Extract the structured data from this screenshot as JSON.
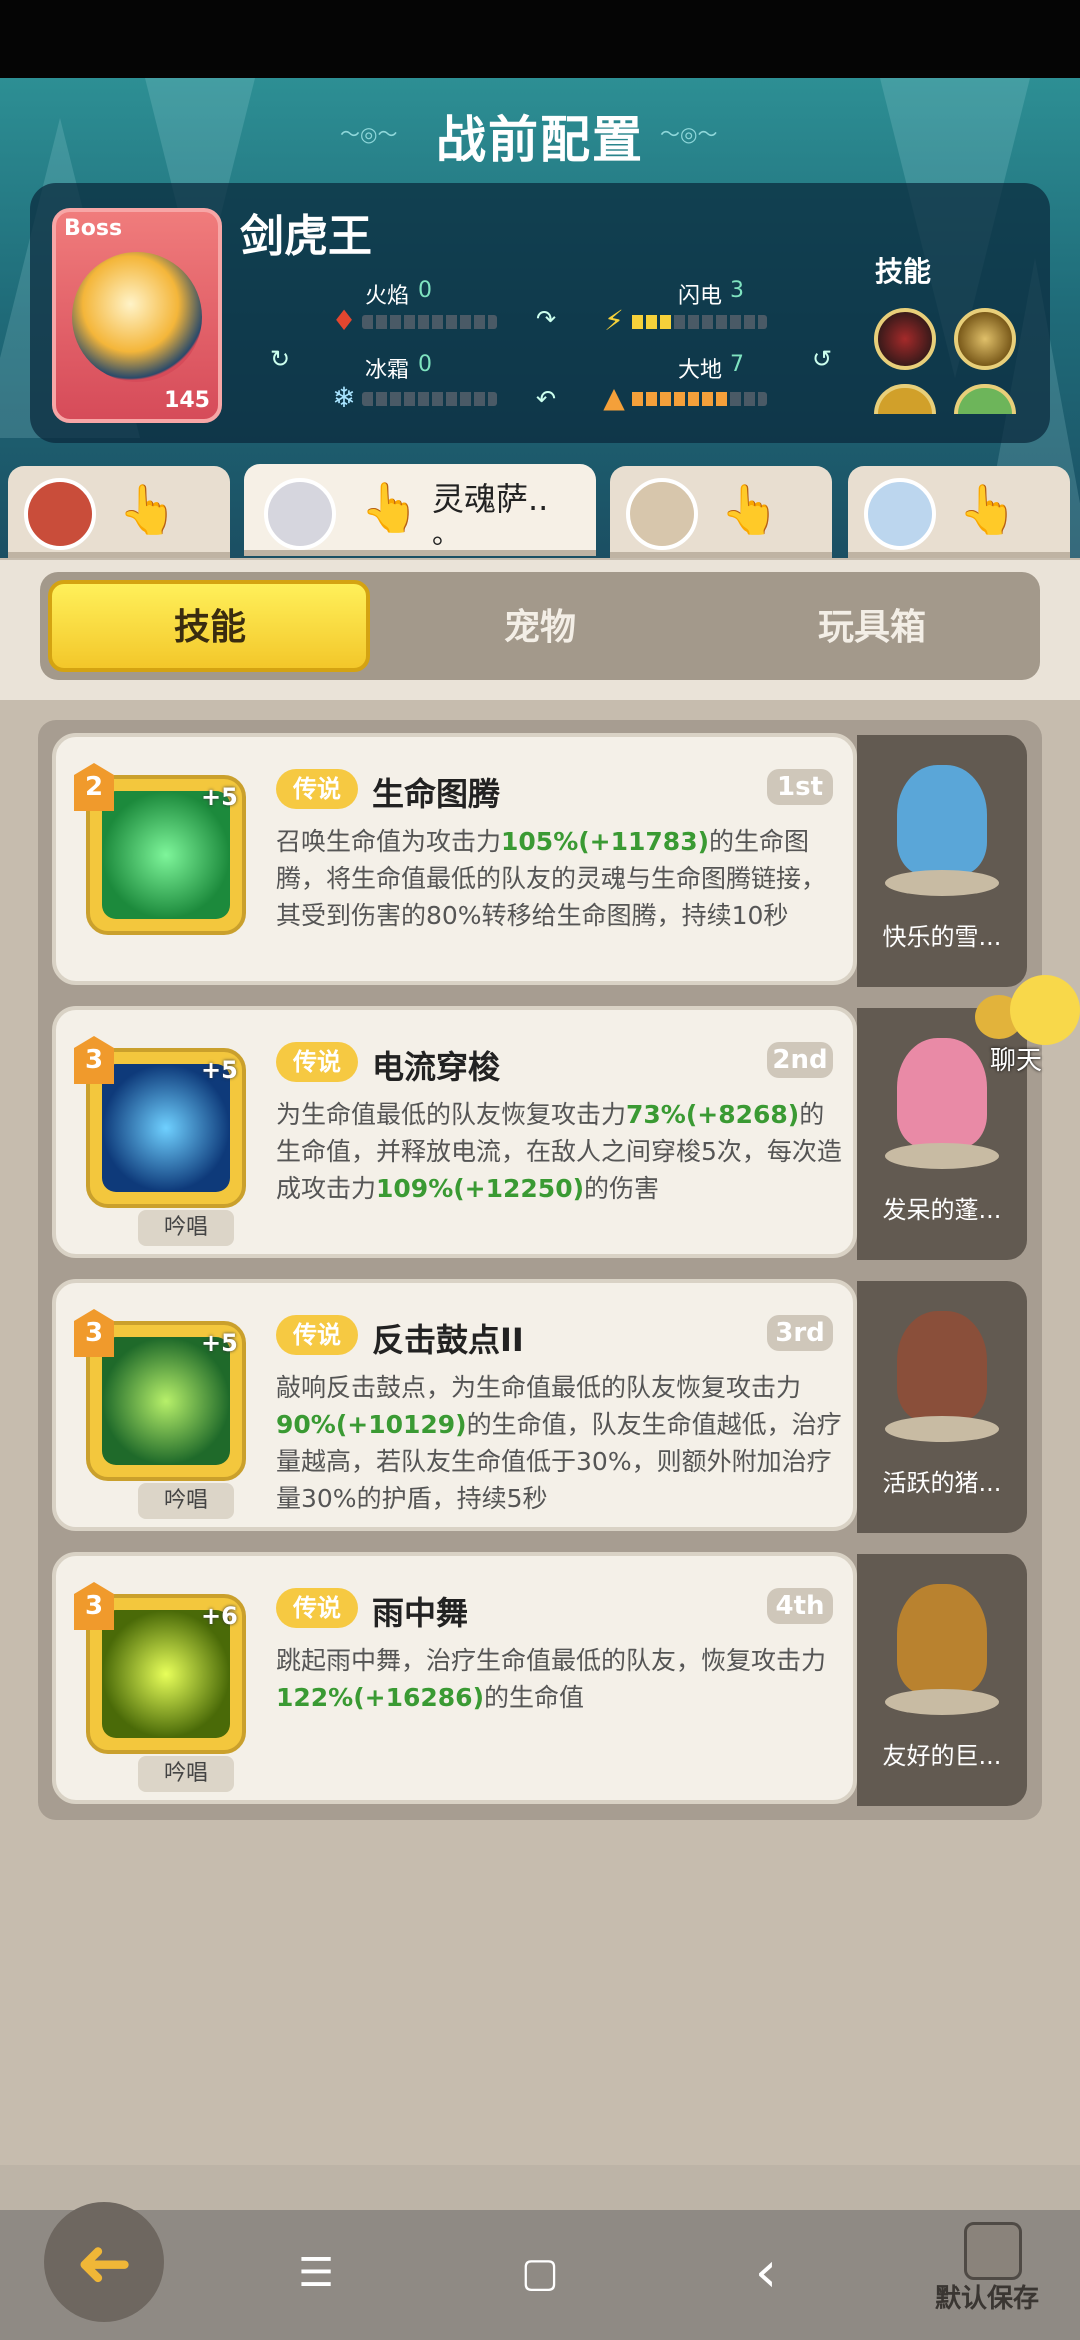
{
  "header": {
    "title": "战前配置"
  },
  "boss": {
    "tag": "Boss",
    "name": "剑虎王",
    "level": "145",
    "elements": [
      {
        "label": "火焰",
        "value": "0",
        "fill": 0
      },
      {
        "label": "闪电",
        "value": "3",
        "fill": 0.3
      },
      {
        "label": "冰霜",
        "value": "0",
        "fill": 0
      },
      {
        "label": "大地",
        "value": "7",
        "fill": 0.7
      }
    ],
    "skills_label": "技能"
  },
  "hero_tabs": [
    {
      "name": "",
      "active": false,
      "avatar_color": "#c94d3a"
    },
    {
      "name": "灵魂萨..",
      "name_line2": "。",
      "active": true,
      "avatar_color": "#d6d6de"
    },
    {
      "name": "",
      "active": false,
      "avatar_color": "#d7c6ac"
    },
    {
      "name": "",
      "active": false,
      "avatar_color": "#bcd6ee"
    }
  ],
  "segments": {
    "skills": "技能",
    "pets": "宠物",
    "toybox": "玩具箱"
  },
  "skills": [
    {
      "level": "2",
      "plus": "+5",
      "tier": "传说",
      "name": "生命图腾",
      "rank": "1st",
      "chant": "",
      "desc_parts": [
        "召唤生命值为攻击力",
        "105%(+11783)",
        "的生命图腾，将生命值最低的队友的灵魂与生命图腾链接，其受到伤害的80%转移给生命图腾，持续10秒"
      ],
      "pet": "快乐的雪...",
      "icon_color": "#2dbd5a"
    },
    {
      "level": "3",
      "plus": "+5",
      "tier": "传说",
      "name": "电流穿梭",
      "rank": "2nd",
      "chant": "吟唱",
      "desc_parts": [
        "为生命值最低的队友恢复攻击力",
        "73%(+8268)",
        "的生命值，并释放电流，在敌人之间穿梭5次，每次造成攻击力",
        "109%(+12250)",
        "的伤害"
      ],
      "pet": "发呆的蓬...",
      "icon_color": "#1a7cd6"
    },
    {
      "level": "3",
      "plus": "+5",
      "tier": "传说",
      "name": "反击鼓点II",
      "rank": "3rd",
      "chant": "吟唱",
      "desc_parts": [
        "敲响反击鼓点，为生命值最低的队友恢复攻击力",
        "90%(+10129)",
        "的生命值，队友生命值越低，治疗量越高，若队友生命值低于30%，则额外附加治疗量30%的护盾，持续5秒"
      ],
      "pet": "活跃的猪...",
      "icon_color": "#2f9a3a"
    },
    {
      "level": "3",
      "plus": "+6",
      "tier": "传说",
      "name": "雨中舞",
      "rank": "4th",
      "chant": "吟唱",
      "desc_parts": [
        "跳起雨中舞，治疗生命值最低的队友，恢复攻击力",
        "122%(+16286)",
        "的生命值"
      ],
      "pet": "友好的巨...",
      "icon_color": "#9bc41e"
    }
  ],
  "chat": {
    "label": "聊天"
  },
  "bottom": {
    "save_label": "默认保存",
    "nav_menu": "☰",
    "nav_home": "▢",
    "nav_back": "‹",
    "back_arrow": "➜"
  },
  "colors": {
    "accent_yellow": "#f6c942",
    "green_value": "#3a9a33"
  }
}
